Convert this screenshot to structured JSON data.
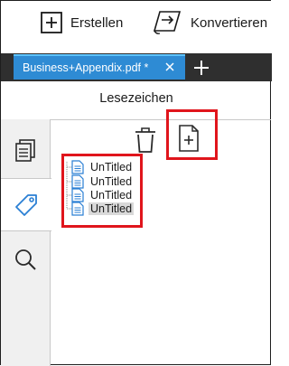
{
  "toolbar": {
    "create_label": "Erstellen",
    "create_icon": "plus-box-icon",
    "convert_label": "Konvertieren",
    "convert_icon": "convert-document-icon"
  },
  "tabs": [
    {
      "title": "Business+Appendix.pdf *",
      "active": true
    }
  ],
  "panel": {
    "title": "Lesezeichen",
    "delete_icon": "trash-icon",
    "add_icon": "add-bookmark-icon"
  },
  "sidebar": {
    "items": [
      {
        "name": "pages",
        "icon": "pages-icon",
        "active": false
      },
      {
        "name": "bookmarks",
        "icon": "bookmark-tag-icon",
        "active": true
      },
      {
        "name": "search",
        "icon": "search-icon",
        "active": false
      }
    ]
  },
  "bookmarks": [
    {
      "label": "UnTitled",
      "selected": false
    },
    {
      "label": "UnTitled",
      "selected": false
    },
    {
      "label": "UnTitled",
      "selected": false
    },
    {
      "label": "UnTitled",
      "selected": true
    }
  ],
  "colors": {
    "tab_active": "#2e8bd4",
    "tabbar_bg": "#2f2f2f",
    "highlight_box": "#e0151c",
    "accent_icon": "#2a7fd4"
  }
}
